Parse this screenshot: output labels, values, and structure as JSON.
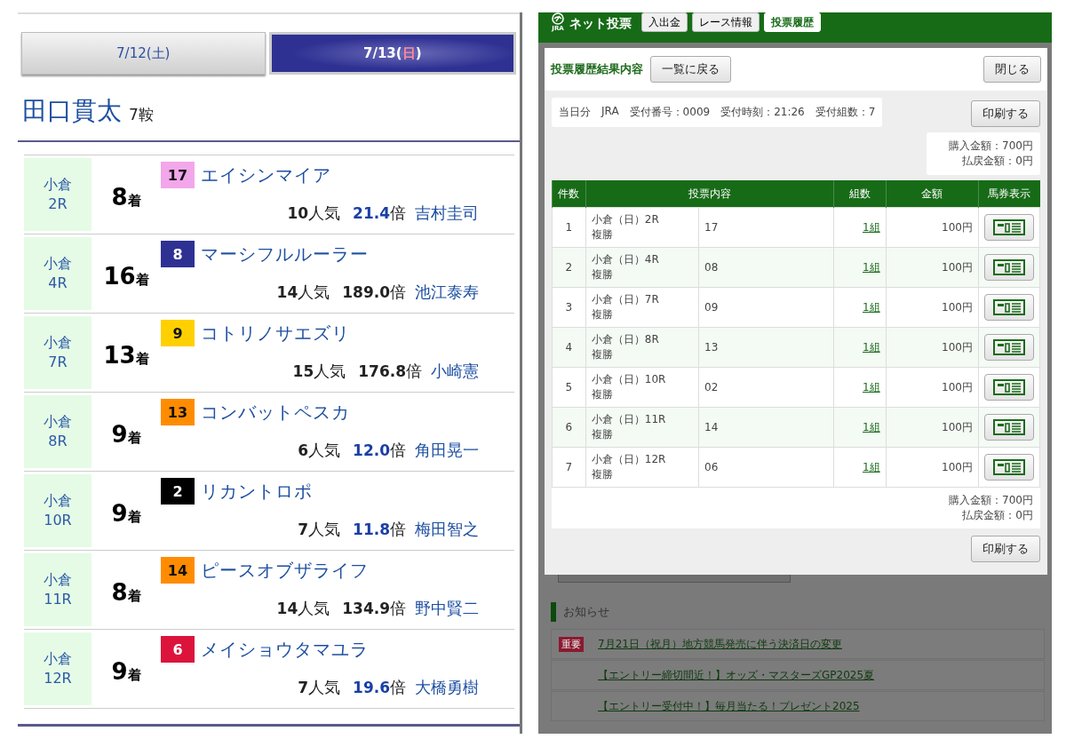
{
  "left": {
    "tabs": [
      {
        "parts": [
          "7/12(",
          "土",
          ")"
        ],
        "day_red": false,
        "selected": false
      },
      {
        "parts": [
          "7/13(",
          "日",
          ")"
        ],
        "day_red": true,
        "selected": true
      }
    ],
    "jockey": {
      "name": "田口貫太",
      "rides": "7鞍"
    },
    "races": [
      {
        "venue": "小倉",
        "race": "2R",
        "finish": "8",
        "finish_unit": "着",
        "number": "17",
        "color": "#f2a7ea",
        "horse": "エイシンマイア",
        "popularity": "10",
        "popularity_unit": "人気",
        "odds": "21.4",
        "odds_unit": "倍",
        "odds_highlighted": true,
        "rider": "吉村圭司"
      },
      {
        "venue": "小倉",
        "race": "4R",
        "finish": "16",
        "finish_unit": "着",
        "number": "8",
        "color": "#2e3192",
        "horse": "マーシフルルーラー",
        "popularity": "14",
        "popularity_unit": "人気",
        "odds": "189.0",
        "odds_unit": "倍",
        "odds_highlighted": false,
        "rider": "池江泰寿"
      },
      {
        "venue": "小倉",
        "race": "7R",
        "finish": "13",
        "finish_unit": "着",
        "number": "9",
        "color": "#ffd000",
        "horse": "コトリノサエズリ",
        "popularity": "15",
        "popularity_unit": "人気",
        "odds": "176.8",
        "odds_unit": "倍",
        "odds_highlighted": false,
        "rider": "小崎憲"
      },
      {
        "venue": "小倉",
        "race": "8R",
        "finish": "9",
        "finish_unit": "着",
        "number": "13",
        "color": "#ff8c00",
        "horse": "コンバットペスカ",
        "popularity": "6",
        "popularity_unit": "人気",
        "odds": "12.0",
        "odds_unit": "倍",
        "odds_highlighted": true,
        "rider": "角田晃一"
      },
      {
        "venue": "小倉",
        "race": "10R",
        "finish": "9",
        "finish_unit": "着",
        "number": "2",
        "color": "#000000",
        "horse": "リカントロポ",
        "popularity": "7",
        "popularity_unit": "人気",
        "odds": "11.8",
        "odds_unit": "倍",
        "odds_highlighted": true,
        "rider": "梅田智之"
      },
      {
        "venue": "小倉",
        "race": "11R",
        "finish": "8",
        "finish_unit": "着",
        "number": "14",
        "color": "#ff8c00",
        "horse": "ピースオブザライフ",
        "popularity": "14",
        "popularity_unit": "人気",
        "odds": "134.9",
        "odds_unit": "倍",
        "odds_highlighted": false,
        "rider": "野中賢二"
      },
      {
        "venue": "小倉",
        "race": "12R",
        "finish": "9",
        "finish_unit": "着",
        "number": "6",
        "color": "#dc143c",
        "horse": "メイショウタマユラ",
        "popularity": "7",
        "popularity_unit": "人気",
        "odds": "19.6",
        "odds_unit": "倍",
        "odds_highlighted": true,
        "rider": "大橋勇樹"
      }
    ]
  },
  "app": {
    "logo_sub": "JRA",
    "logo_text": "ネット投票",
    "tabs": [
      {
        "label": "入出金",
        "selected": false
      },
      {
        "label": "レース情報",
        "selected": false
      },
      {
        "label": "投票履歴",
        "selected": true
      }
    ]
  },
  "modal": {
    "title": "投票履歴結果内容",
    "back_button": "一覧に戻る",
    "close_button": "閉じる",
    "info": [
      "当日分",
      "JRA",
      "受付番号：0009",
      "受付時刻：21:26",
      "受付組数：7"
    ],
    "print_button": "印刷する",
    "totals": [
      "購入金額：700円",
      "払戻金額：0円"
    ],
    "table": {
      "columns": [
        "件数",
        "投票内容",
        "組数",
        "金額",
        "馬券表示"
      ],
      "rows": [
        {
          "no": "1",
          "race": "小倉（日）2R",
          "bet_type": "複勝",
          "selection": "17",
          "combos": "1組",
          "amount": "100円"
        },
        {
          "no": "2",
          "race": "小倉（日）4R",
          "bet_type": "複勝",
          "selection": "08",
          "combos": "1組",
          "amount": "100円"
        },
        {
          "no": "3",
          "race": "小倉（日）7R",
          "bet_type": "複勝",
          "selection": "09",
          "combos": "1組",
          "amount": "100円"
        },
        {
          "no": "4",
          "race": "小倉（日）8R",
          "bet_type": "複勝",
          "selection": "13",
          "combos": "1組",
          "amount": "100円"
        },
        {
          "no": "5",
          "race": "小倉（日）10R",
          "bet_type": "複勝",
          "selection": "02",
          "combos": "1組",
          "amount": "100円"
        },
        {
          "no": "6",
          "race": "小倉（日）11R",
          "bet_type": "複勝",
          "selection": "14",
          "combos": "1組",
          "amount": "100円"
        },
        {
          "no": "7",
          "race": "小倉（日）12R",
          "bet_type": "複勝",
          "selection": "06",
          "combos": "1組",
          "amount": "100円"
        }
      ]
    },
    "footer_totals": [
      "購入金額：700円",
      "払戻金額：0円"
    ],
    "footer_print_button": "印刷する"
  },
  "notices": {
    "title": "お知らせ",
    "items": [
      {
        "badge": "重要",
        "text": "7月21日（祝月）地方競馬発売に伴う決済日の変更"
      },
      {
        "text": "【エントリー締切間近！】オッズ・マスターズGP2025夏"
      },
      {
        "text": "【エントリー受付中！】毎月当たる！プレゼント2025"
      }
    ]
  }
}
